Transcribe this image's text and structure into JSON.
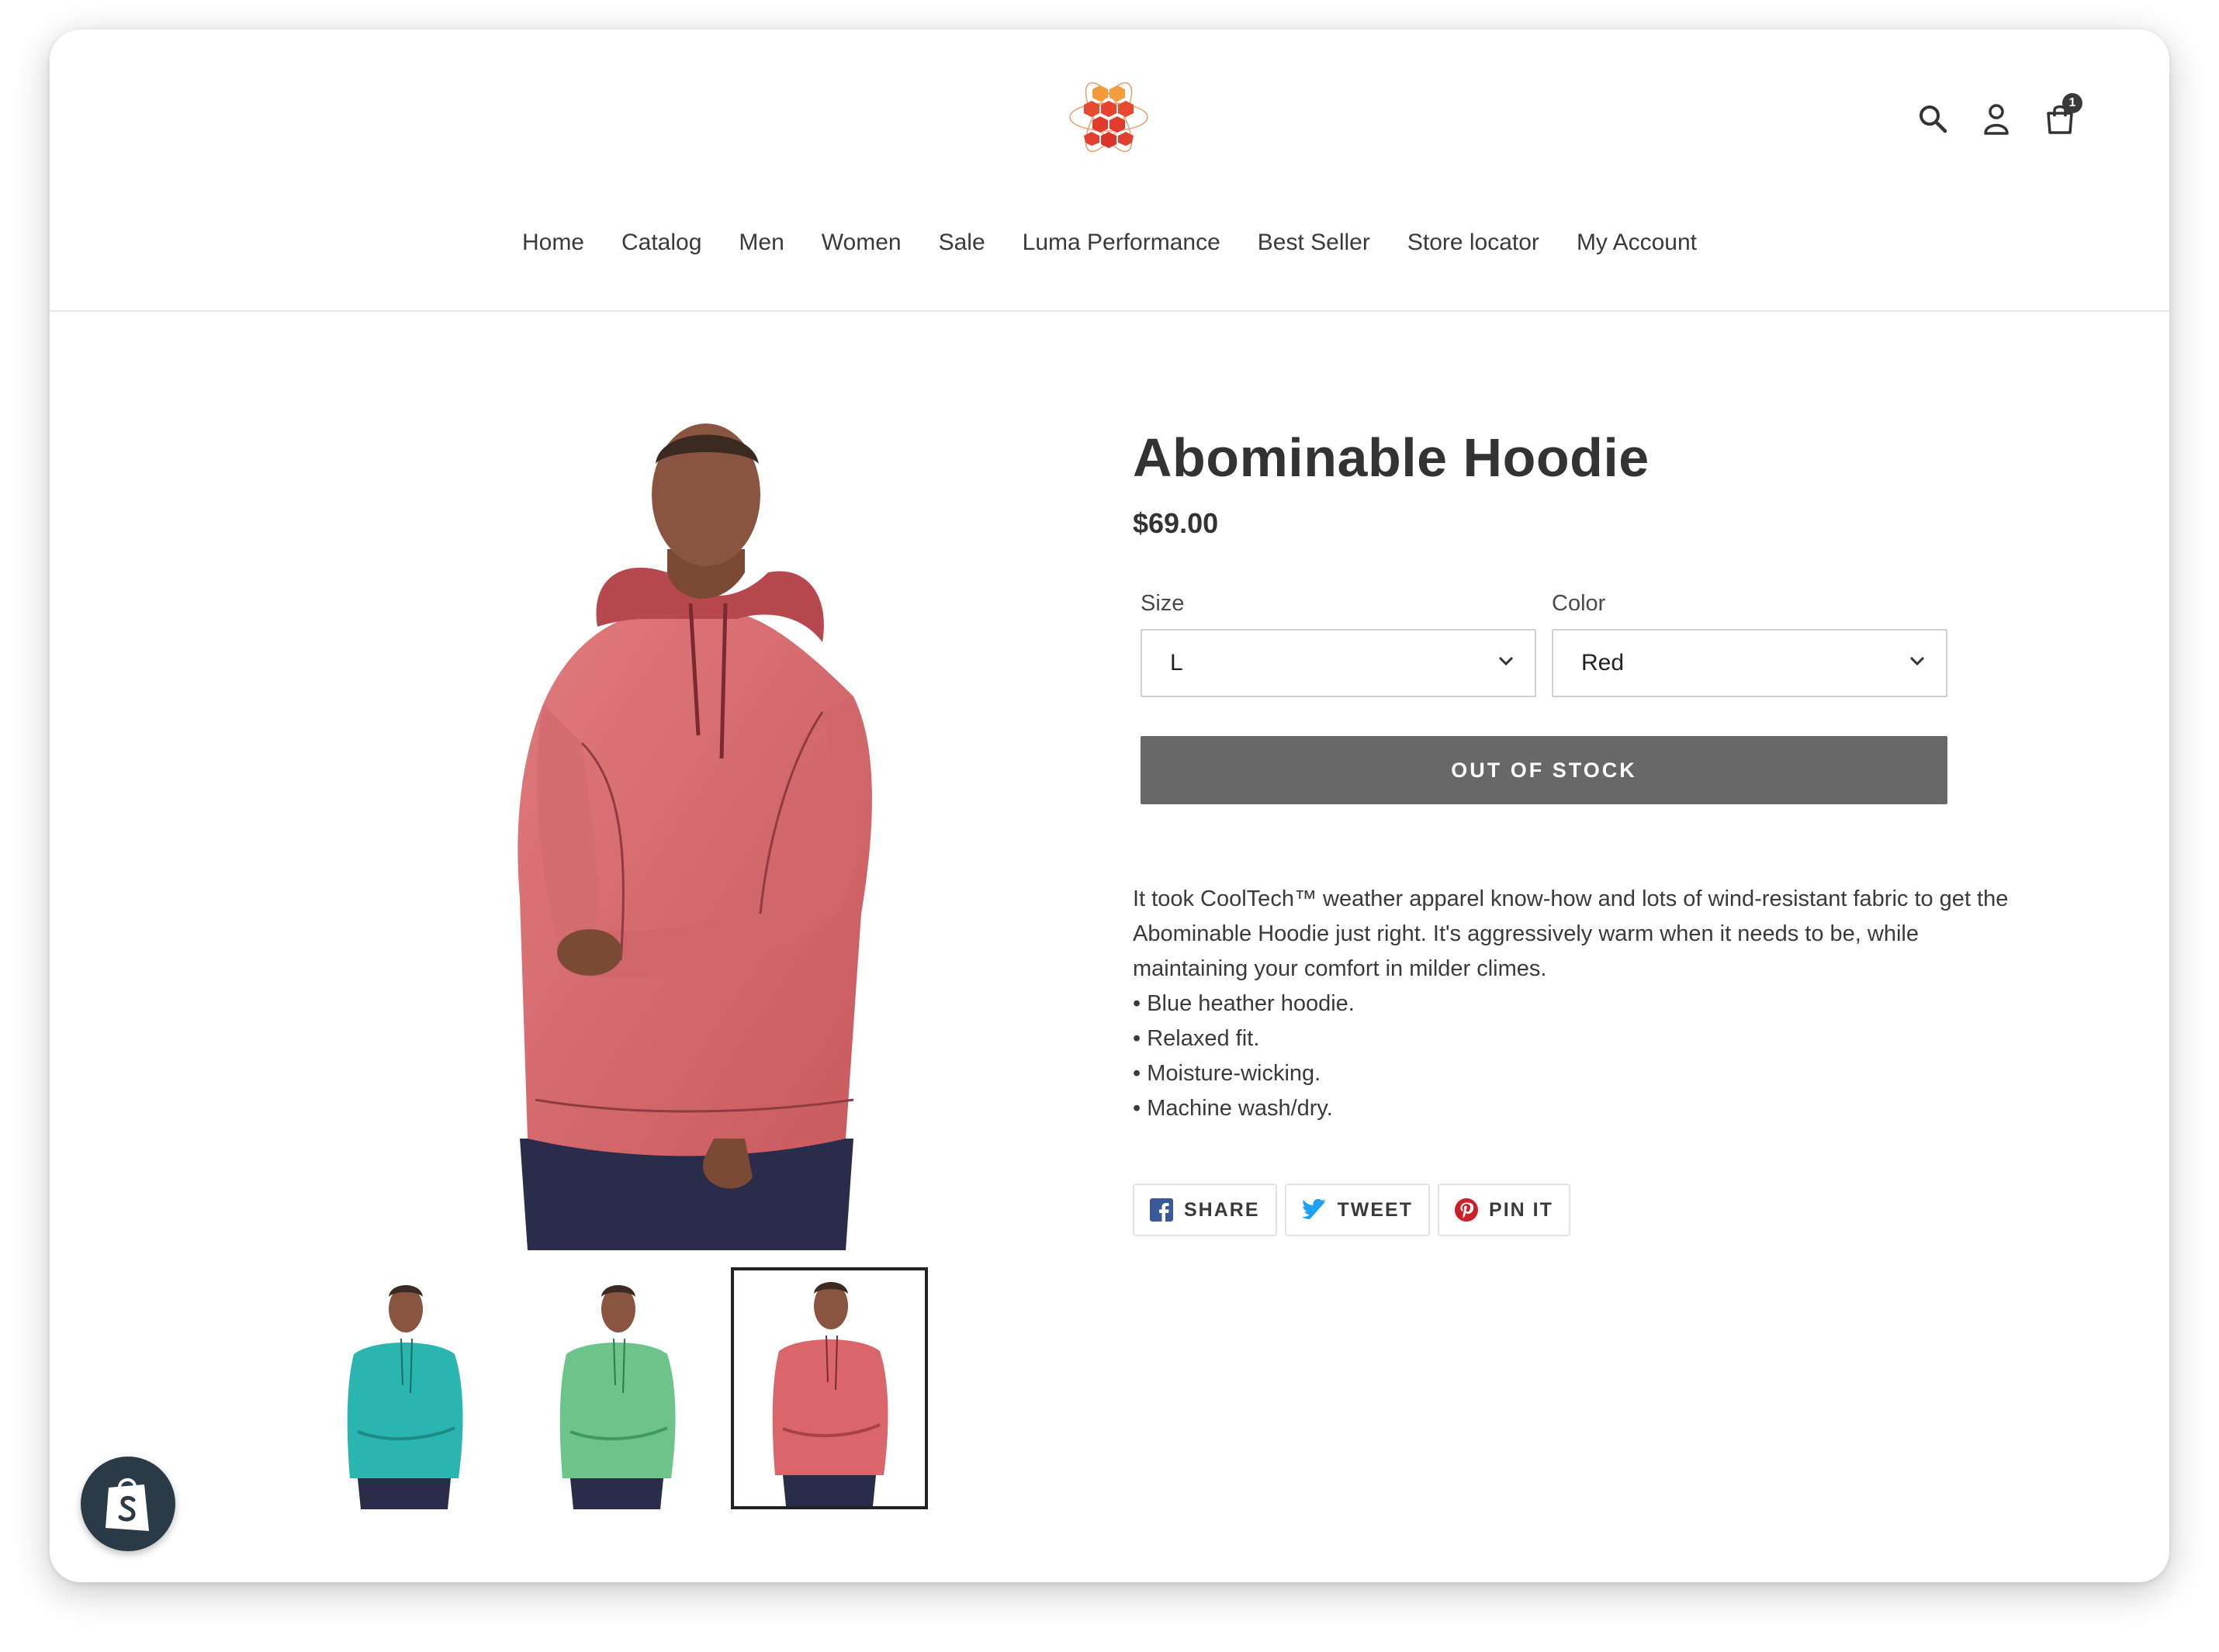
{
  "header": {
    "nav": [
      "Home",
      "Catalog",
      "Men",
      "Women",
      "Sale",
      "Luma Performance",
      "Best Seller",
      "Store locator",
      "My Account"
    ],
    "cart_count": "1",
    "icons": [
      "search-icon",
      "account-icon",
      "cart-icon"
    ]
  },
  "product": {
    "title": "Abominable Hoodie",
    "price": "$69.00",
    "size_label": "Size",
    "size_value": "L",
    "color_label": "Color",
    "color_value": "Red",
    "button_label": "OUT OF STOCK",
    "description": "It took CoolTech™ weather apparel know-how and lots of wind-resistant fabric to get the Abominable Hoodie just right. It's aggressively warm when it needs to be, while maintaining your comfort in milder climes.",
    "bullets": [
      "• Blue heather hoodie.",
      "• Relaxed fit.",
      "• Moisture-wicking.",
      "• Machine wash/dry."
    ]
  },
  "thumbnails": [
    {
      "color": "#2bb5b0",
      "selected": false
    },
    {
      "color": "#6cc48a",
      "selected": false
    },
    {
      "color": "#d8666b",
      "selected": true
    }
  ],
  "social": {
    "share": "SHARE",
    "tweet": "TWEET",
    "pin": "PIN IT"
  },
  "colors": {
    "facebook": "#3b5998",
    "twitter": "#1da1f2",
    "pinterest": "#cb2027",
    "button_gray": "#686868",
    "hoodie_red": "#d8666b"
  }
}
